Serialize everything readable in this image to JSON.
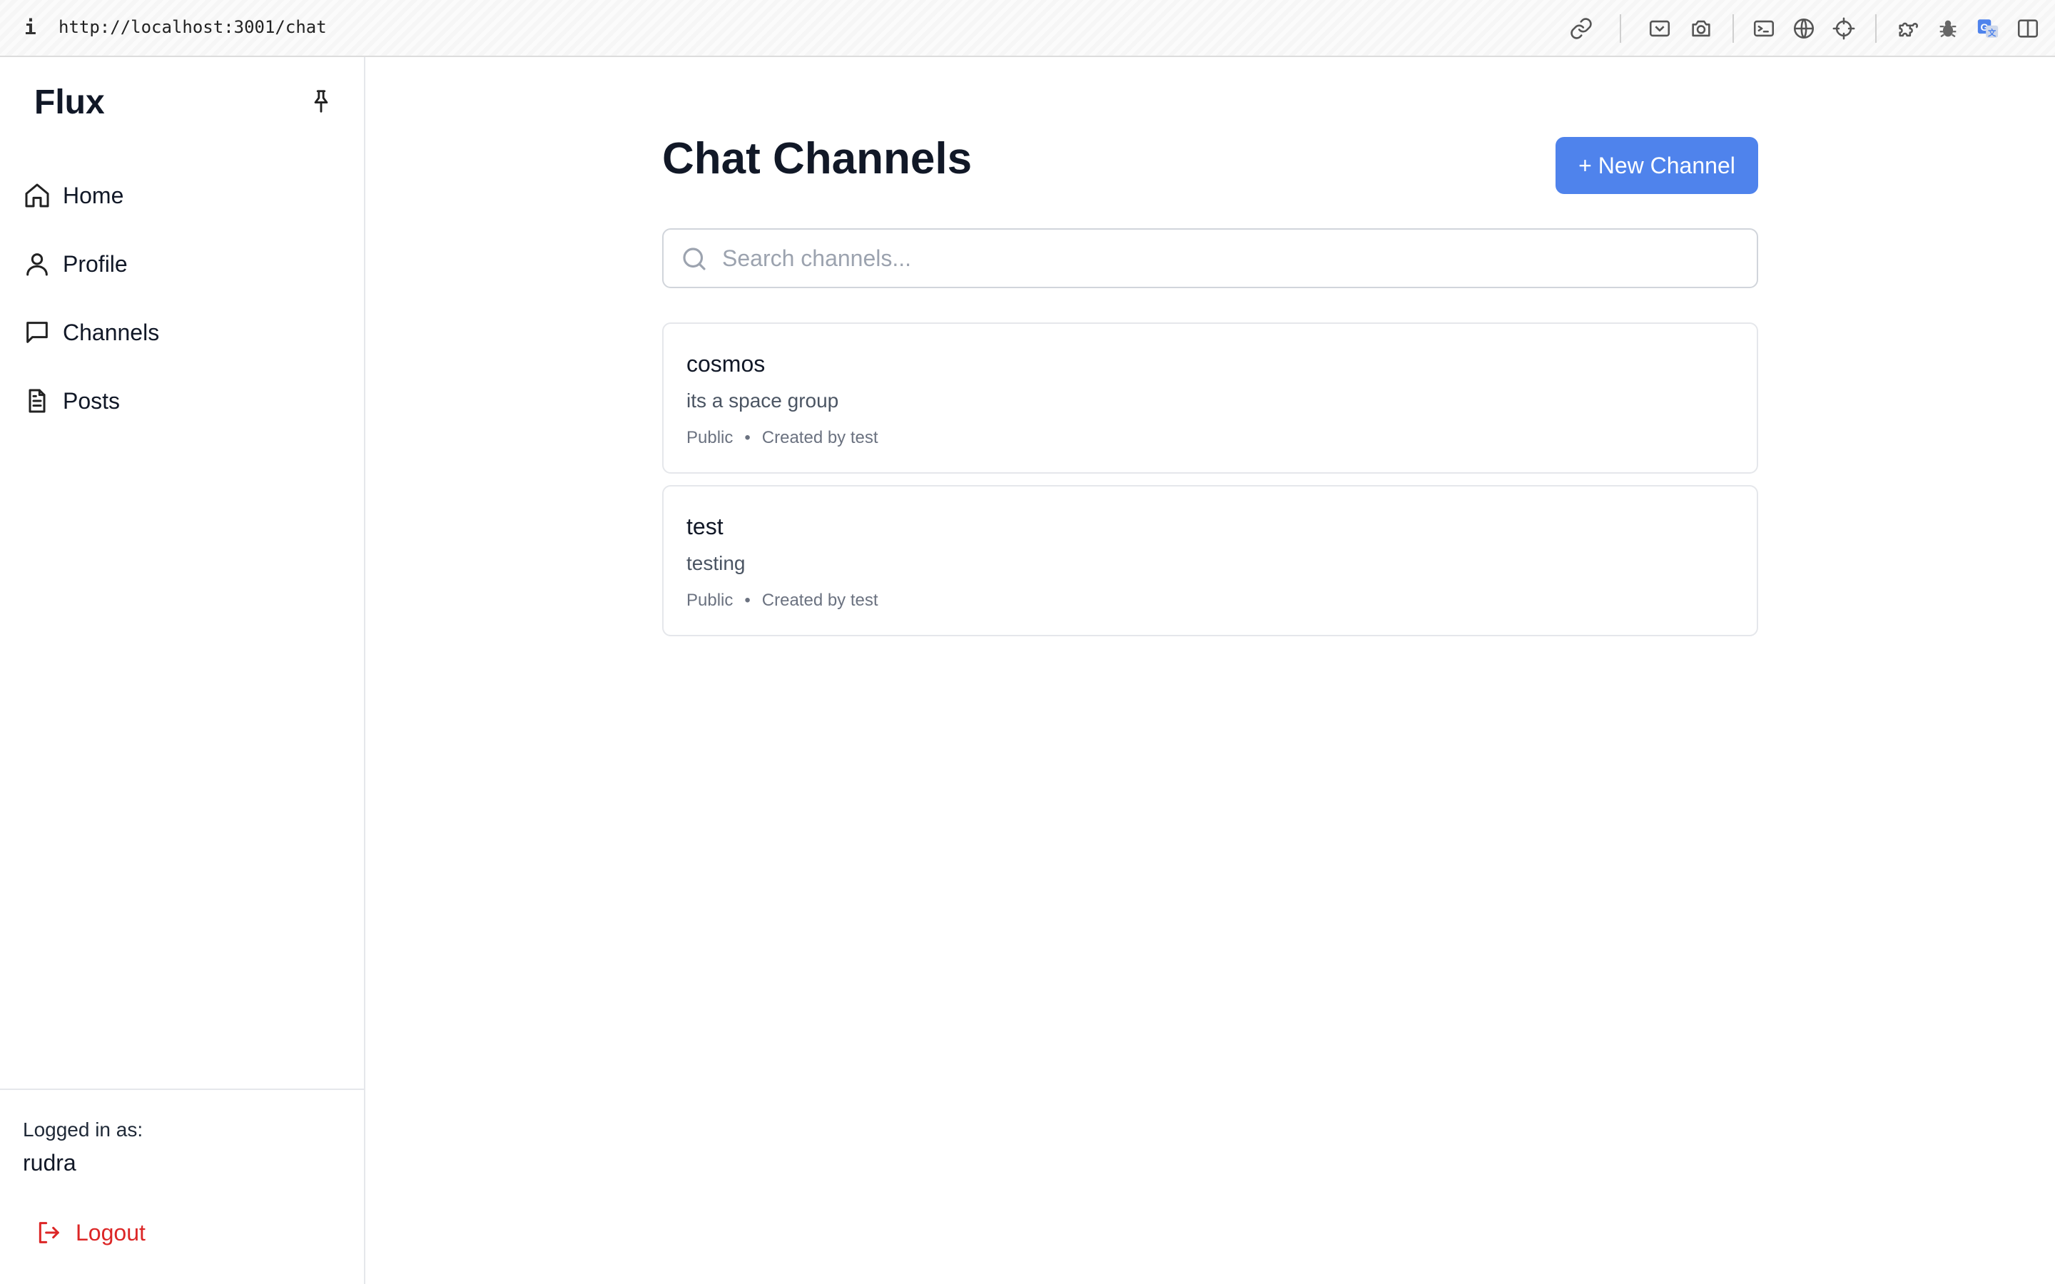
{
  "browser": {
    "info_glyph": "i",
    "url": "http://localhost:3001/chat",
    "toolbar_icons": [
      "link-icon",
      "screenshot-area-icon",
      "camera-icon",
      "terminal-icon",
      "globe-icon",
      "crosshair-icon",
      "extension-puzzle-icon",
      "bug-icon",
      "translate-icon",
      "sidebar-toggle-icon"
    ]
  },
  "sidebar": {
    "brand": "Flux",
    "items": [
      {
        "label": "Home",
        "icon": "home-icon"
      },
      {
        "label": "Profile",
        "icon": "user-icon"
      },
      {
        "label": "Channels",
        "icon": "message-square-icon"
      },
      {
        "label": "Posts",
        "icon": "file-text-icon"
      }
    ],
    "logged_in_label": "Logged in as:",
    "username": "rudra",
    "logout_label": "Logout"
  },
  "main": {
    "title": "Chat Channels",
    "new_channel_label": "+ New Channel",
    "search": {
      "placeholder": "Search channels...",
      "value": ""
    },
    "channels": [
      {
        "name": "cosmos",
        "description": "its a space group",
        "visibility": "Public",
        "separator": "•",
        "created_by": "Created by test"
      },
      {
        "name": "test",
        "description": "testing",
        "visibility": "Public",
        "separator": "•",
        "created_by": "Created by test"
      }
    ]
  },
  "colors": {
    "accent": "#4f83ec",
    "danger": "#dc2626",
    "border": "#e5e7eb"
  }
}
